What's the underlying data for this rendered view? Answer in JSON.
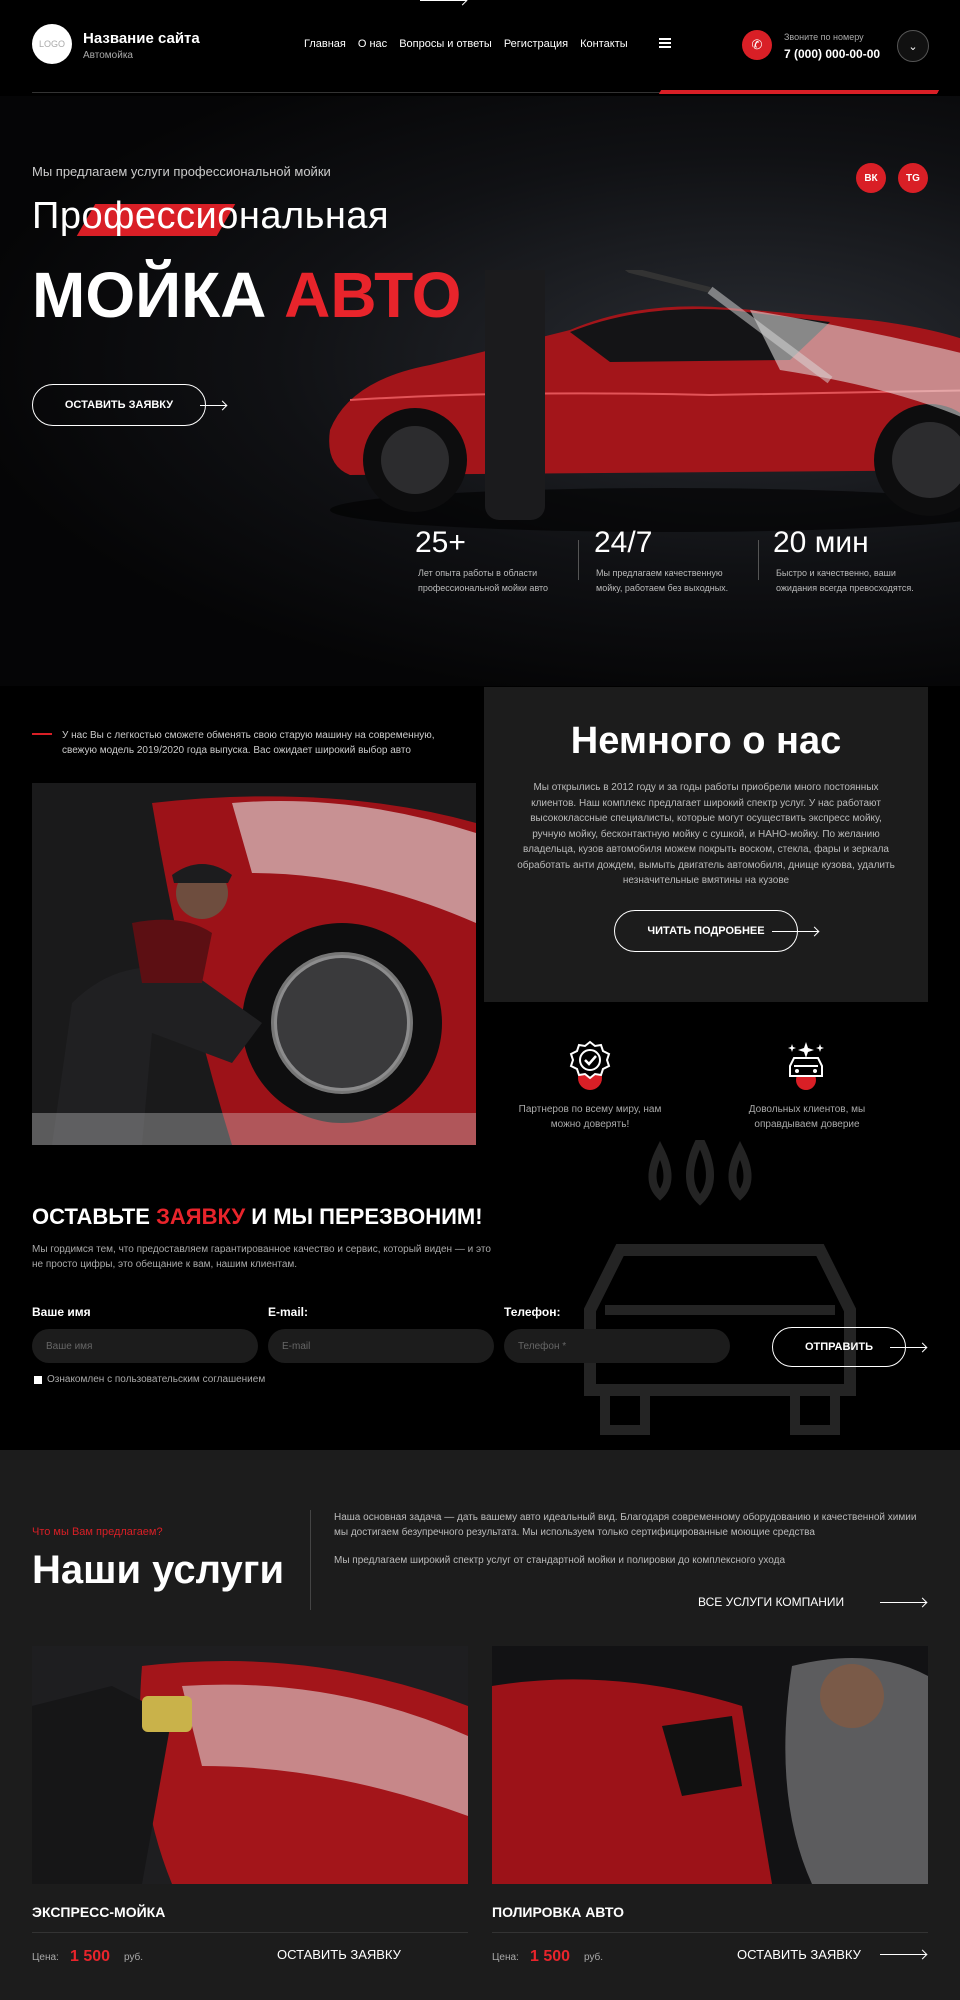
{
  "header": {
    "logo": "LOGO",
    "site_name": "Название сайта",
    "site_sub": "Автомойка",
    "nav": [
      "Главная",
      "О нас",
      "Вопросы и ответы",
      "Регистрация",
      "Контакты"
    ],
    "call_label": "Звоните по номеру",
    "phone": "7 (000) 000-00-00"
  },
  "hero": {
    "pretitle": "Мы предлагаем услуги профессиональной мойки",
    "title_line1": "Профессиональная",
    "title_line2_white": "МОЙКА",
    "title_line2_red": "АВТО",
    "cta": "ОСТАВИТЬ ЗАЯВКУ",
    "social": [
      "ВК",
      "TG"
    ],
    "stats": [
      {
        "num": "25+",
        "desc": "Лет опыта работы в области профессиональной мойки авто"
      },
      {
        "num": "24/7",
        "desc": "Мы предлагаем качественную мойку, работаем без выходных."
      },
      {
        "num": "20 мин",
        "desc": "Быстро и качественно, ваши ожидания всегда превосходятся."
      }
    ]
  },
  "about": {
    "intro": "У нас Вы с легкостью сможете обменять свою старую машину на современную, свежую модель 2019/2020 года выпуска.  Вас ожидает широкий выбор  авто",
    "title": "Немного о нас",
    "text": "Мы открылись в 2012 году и за годы работы приобрели много постоянных клиентов. Наш комплекс предлагает широкий спектр услуг. У нас работают высококлассные специалисты, которые могут осуществить экспресс мойку, ручную мойку, бесконтактную мойку с сушкой, и НАНО-мойку. По желанию владельца, кузов автомобиля можем покрыть воском, стекла, фары и зеркала обработать анти дождем, вымыть двигатель автомобиля, днище кузова, удалить незначительные вмятины на кузове",
    "cta": "ЧИТАТЬ ПОДРОБНЕЕ",
    "features": [
      {
        "icon": "badge-check-icon",
        "text": "Партнеров по всему миру, нам можно доверять!"
      },
      {
        "icon": "car-sparkle-icon",
        "text": "Довольных клиентов, мы оправдываем доверие"
      }
    ]
  },
  "form": {
    "title_a": "ОСТАВЬТЕ",
    "title_red": "ЗАЯВКУ",
    "title_b": "И МЫ ПЕРЕЗВОНИМ!",
    "desc": "Мы гордимся тем, что предоставляем гарантированное качество и сервис, который виден — и это не просто цифры, это обещание к вам, нашим клиентам.",
    "name_label": "Ваше имя",
    "name_ph": "Ваше имя",
    "email_label": "E-mail:",
    "email_ph": "E-mail",
    "phone_label": "Телефон:",
    "phone_ph": "Телефон *",
    "submit": "ОТПРАВИТЬ",
    "agree": "Ознакомлен с пользовательским соглашением"
  },
  "services": {
    "pretitle": "Что мы Вам предлагаем?",
    "title": "Наши услуги",
    "p1": "Наша основная задача — дать вашему авто идеальный вид. Благодаря современному оборудованию и качественной химии мы достигаем безупречного результата. Мы используем только сертифицированные моющие средства",
    "p2": "Мы предлагаем широкий спектр услуг от стандартной мойки и полировки до комплексного ухода",
    "all_link": "ВСЕ УСЛУГИ КОМПАНИИ",
    "cards": [
      {
        "title": "ЭКСПРЕСС-МОЙКА",
        "price_label": "Цена:",
        "price": "1 500",
        "currency": "руб.",
        "cta": "ОСТАВИТЬ ЗАЯВКУ"
      },
      {
        "title": "ПОЛИРОВКА АВТО",
        "price_label": "Цена:",
        "price": "1 500",
        "currency": "руб.",
        "cta": "ОСТАВИТЬ ЗАЯВКУ"
      }
    ]
  },
  "colors": {
    "accent": "#d91f26",
    "bg": "#000000",
    "panel": "#1c1c1c"
  }
}
